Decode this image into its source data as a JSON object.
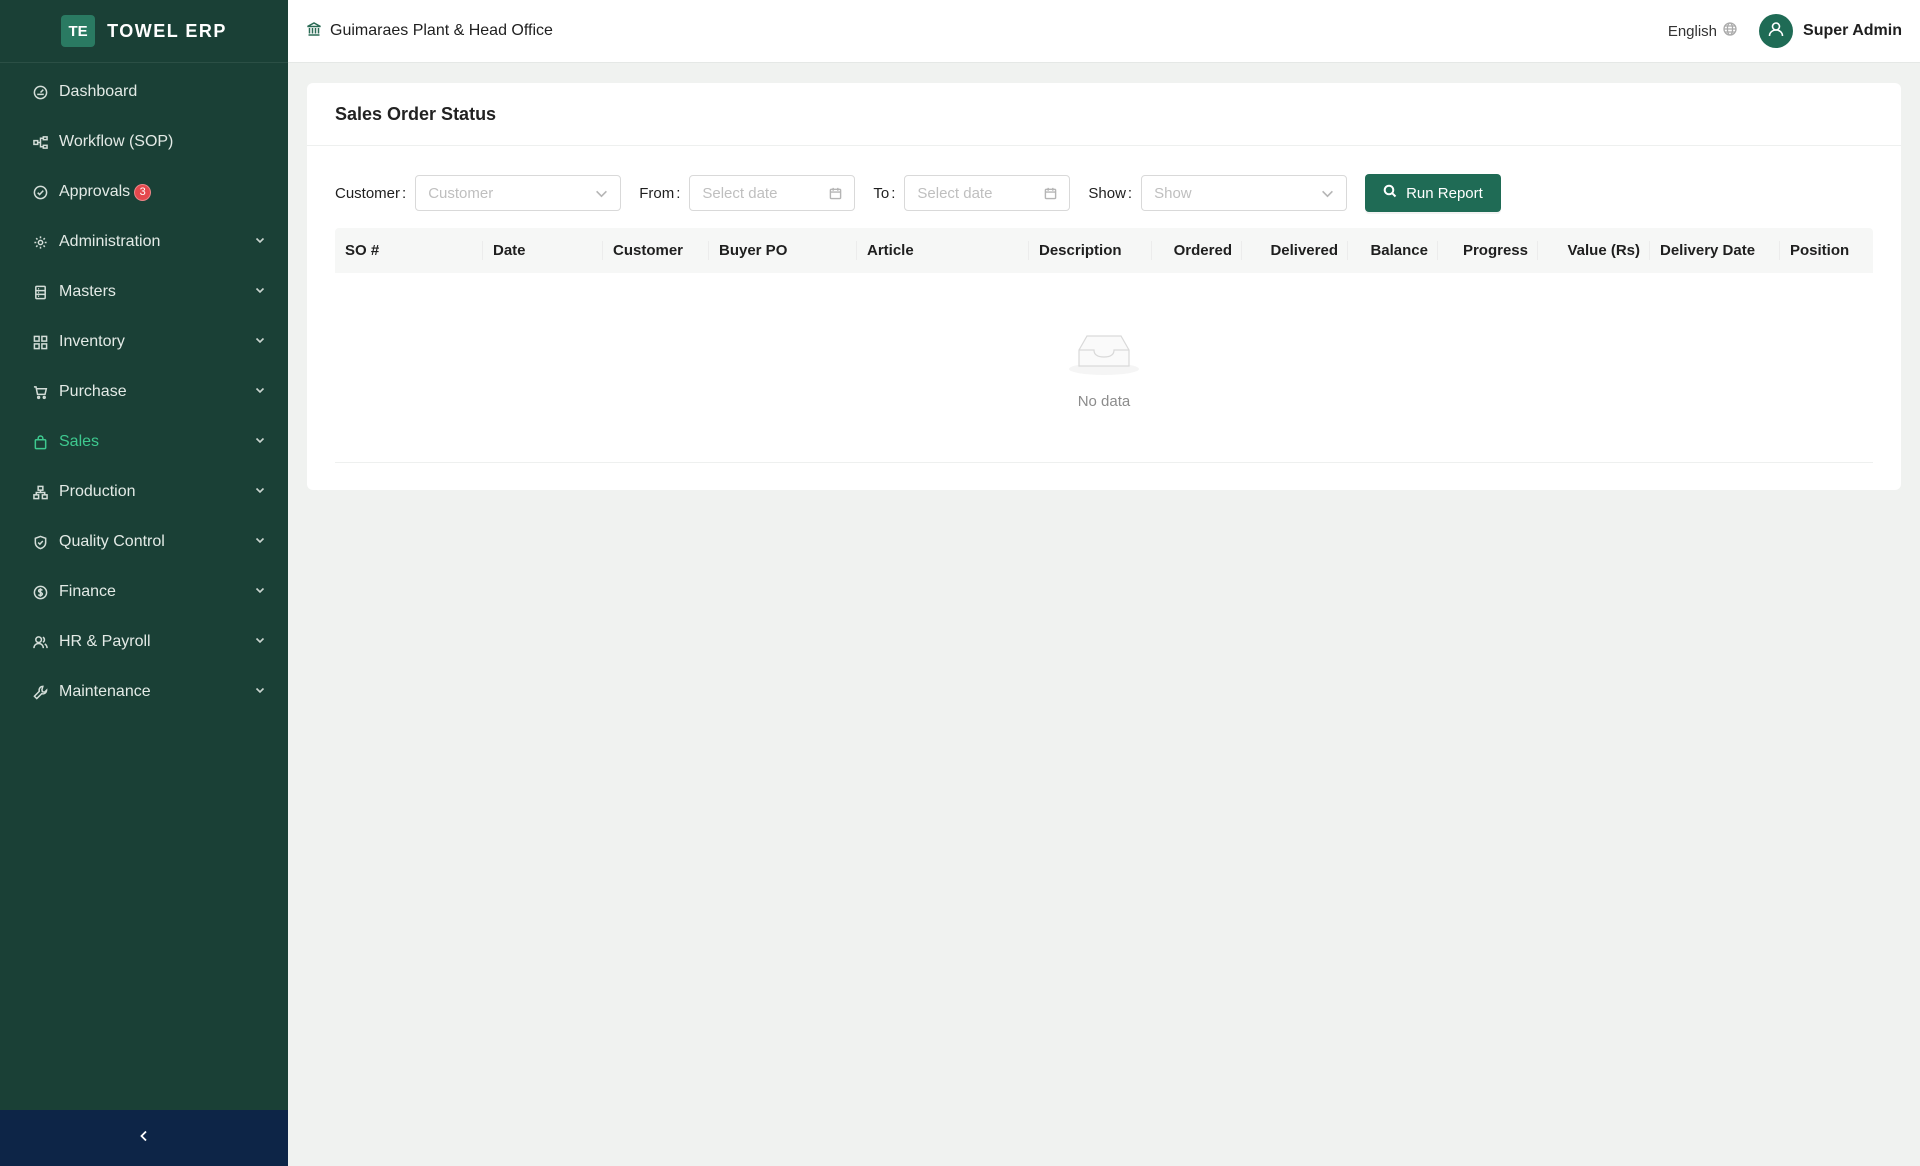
{
  "brand": {
    "logo": "TE",
    "name": "TOWEL ERP"
  },
  "sidebar": {
    "items": [
      {
        "label": "Dashboard",
        "icon": "dashboard-icon",
        "expandable": false
      },
      {
        "label": "Workflow (SOP)",
        "icon": "workflow-icon",
        "expandable": false
      },
      {
        "label": "Approvals",
        "icon": "check-circle-icon",
        "expandable": false,
        "badge": "3"
      },
      {
        "label": "Administration",
        "icon": "gear-icon",
        "expandable": true
      },
      {
        "label": "Masters",
        "icon": "database-icon",
        "expandable": true
      },
      {
        "label": "Inventory",
        "icon": "grid-icon",
        "expandable": true
      },
      {
        "label": "Purchase",
        "icon": "cart-icon",
        "expandable": true
      },
      {
        "label": "Sales",
        "icon": "shopping-bag-icon",
        "expandable": true,
        "active": true
      },
      {
        "label": "Production",
        "icon": "cluster-icon",
        "expandable": true
      },
      {
        "label": "Quality Control",
        "icon": "shield-check-icon",
        "expandable": true
      },
      {
        "label": "Finance",
        "icon": "dollar-circle-icon",
        "expandable": true
      },
      {
        "label": "HR & Payroll",
        "icon": "team-icon",
        "expandable": true
      },
      {
        "label": "Maintenance",
        "icon": "tool-icon",
        "expandable": true
      }
    ]
  },
  "header": {
    "org": "Guimaraes Plant & Head Office",
    "language": "English",
    "user": "Super Admin"
  },
  "report": {
    "title": "Sales Order Status",
    "filters": {
      "customer_label": "Customer",
      "customer_placeholder": "Customer",
      "from_label": "From",
      "from_placeholder": "Select date",
      "to_label": "To",
      "to_placeholder": "Select date",
      "show_label": "Show",
      "show_placeholder": "Show"
    },
    "run_button": "Run Report",
    "columns": [
      "SO #",
      "Date",
      "Customer",
      "Buyer PO",
      "Article",
      "Description",
      "Ordered",
      "Delivered",
      "Balance",
      "Progress",
      "Value (Rs)",
      "Delivery Date",
      "Position"
    ],
    "rows": [],
    "empty_text": "No data"
  },
  "colors": {
    "sidebar_bg": "#1a4036",
    "primary": "#1f6b55",
    "active_nav": "#3ec98f",
    "collapse_bar": "#0d2547",
    "badge": "#e5484d"
  }
}
